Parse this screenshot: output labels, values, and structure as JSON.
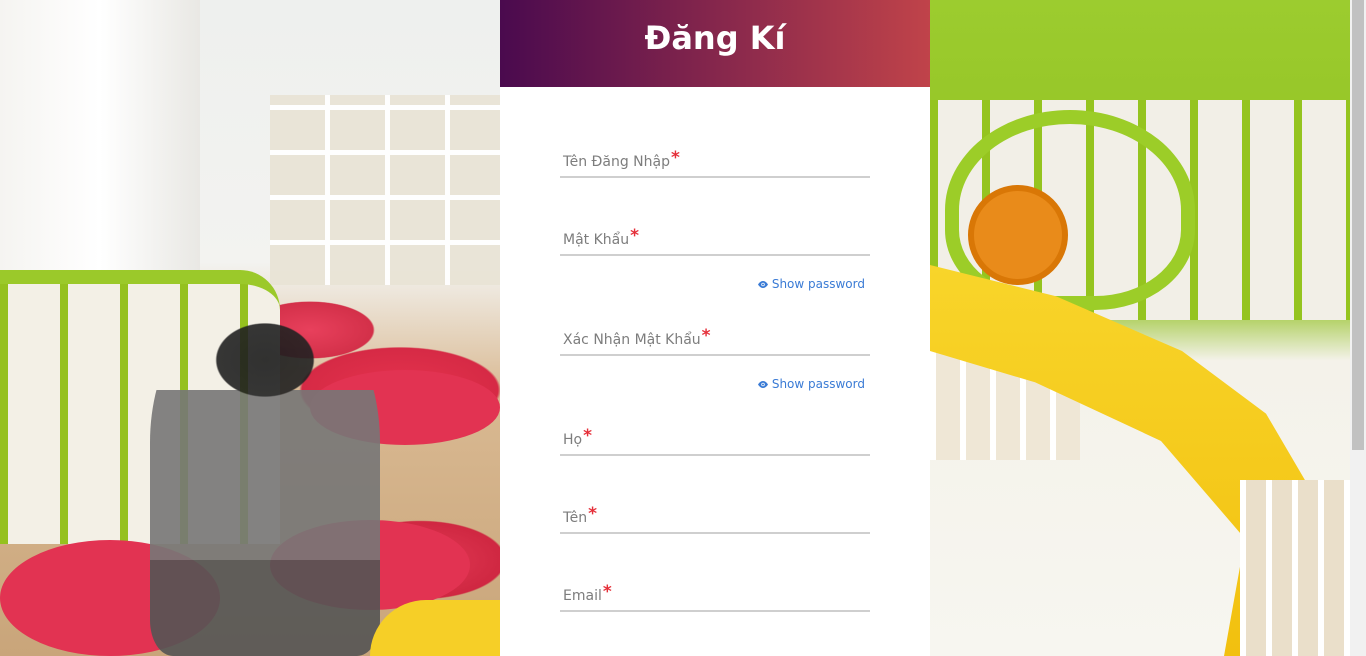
{
  "header": {
    "title": "Đăng Kí",
    "gradient_start": "#4a0a4e",
    "gradient_end": "#c0434a"
  },
  "fields": [
    {
      "label": "Tên Đăng Nhập",
      "required_mark": "*",
      "type": "text",
      "value": ""
    },
    {
      "label": "Mật Khẩu",
      "required_mark": "*",
      "type": "password",
      "value": ""
    },
    {
      "label": "Xác Nhận Mật Khẩu",
      "required_mark": "*",
      "type": "password",
      "value": ""
    },
    {
      "label": "Họ",
      "required_mark": "*",
      "type": "text",
      "value": ""
    },
    {
      "label": "Tên",
      "required_mark": "*",
      "type": "text",
      "value": ""
    },
    {
      "label": "Email",
      "required_mark": "*",
      "type": "email",
      "value": ""
    }
  ],
  "show_password": {
    "label": "Show password",
    "icon": "eye-icon",
    "color": "#3a7bd5"
  },
  "colors": {
    "required": "#e5303a",
    "label": "#7d7d7d",
    "underline": "#cfcfcf"
  }
}
